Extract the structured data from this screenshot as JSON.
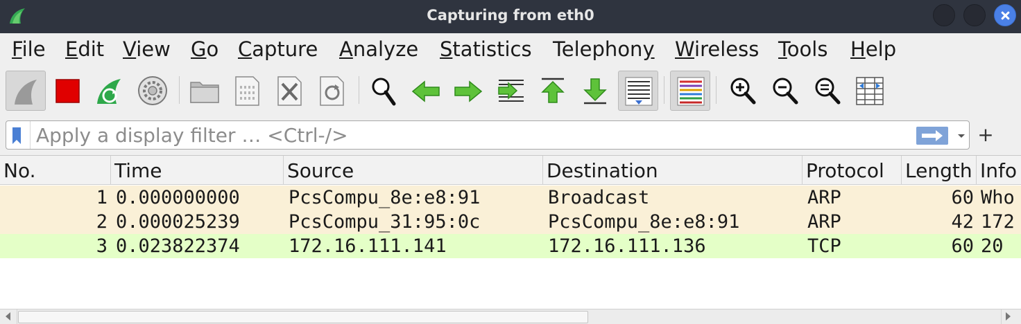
{
  "window": {
    "title": "Capturing from eth0",
    "buttons": [
      "minimize",
      "maximize",
      "close"
    ]
  },
  "menu": [
    {
      "label": "File",
      "mnemonic": "F",
      "rest": "ile"
    },
    {
      "label": "Edit",
      "mnemonic": "E",
      "rest": "dit"
    },
    {
      "label": "View",
      "mnemonic": "V",
      "rest": "iew"
    },
    {
      "label": "Go",
      "mnemonic": "G",
      "rest": "o"
    },
    {
      "label": "Capture",
      "mnemonic": "C",
      "rest": "apture"
    },
    {
      "label": "Analyze",
      "mnemonic": "A",
      "rest": "nalyze"
    },
    {
      "label": "Statistics",
      "mnemonic": "S",
      "rest": "tatistics"
    },
    {
      "label": "Telephony",
      "mnemonic": "y",
      "rest_before": "Telephon"
    },
    {
      "label": "Wireless",
      "mnemonic": "W",
      "rest": "ireless"
    },
    {
      "label": "Tools",
      "mnemonic": "T",
      "rest": "ools"
    },
    {
      "label": "Help",
      "mnemonic": "H",
      "rest": "elp"
    }
  ],
  "toolbar": {
    "icons": [
      "start-capture-icon",
      "stop-capture-icon",
      "restart-capture-icon",
      "capture-options-icon",
      "open-file-icon",
      "save-file-icon",
      "close-file-icon",
      "reload-file-icon",
      "find-packet-icon",
      "go-back-icon",
      "go-forward-icon",
      "go-to-packet-icon",
      "go-first-packet-icon",
      "go-last-packet-icon",
      "autoscroll-icon",
      "colorize-icon",
      "zoom-in-icon",
      "zoom-out-icon",
      "normal-size-icon",
      "resize-columns-icon"
    ]
  },
  "filter": {
    "placeholder": "Apply a display filter … <Ctrl-/>",
    "value": "",
    "add_label": "+"
  },
  "packets": {
    "columns": [
      "No.",
      "Time",
      "Source",
      "Destination",
      "Protocol",
      "Length",
      "Info"
    ],
    "rows": [
      {
        "no": "1",
        "time": "0.000000000",
        "source": "PcsCompu_8e:e8:91",
        "destination": "Broadcast",
        "protocol": "ARP",
        "length": "60",
        "info": "Who",
        "color": "#faf0d7"
      },
      {
        "no": "2",
        "time": "0.000025239",
        "source": "PcsCompu_31:95:0c",
        "destination": "PcsCompu_8e:e8:91",
        "protocol": "ARP",
        "length": "42",
        "info": "172",
        "color": "#faf0d7"
      },
      {
        "no": "3",
        "time": "0.023822374",
        "source": "172.16.111.141",
        "destination": "172.16.111.136",
        "protocol": "TCP",
        "length": "60",
        "info": "20",
        "color": "#e4ffc7"
      }
    ]
  },
  "colors": {
    "titlebar": "#2f343f",
    "close_button": "#4a80e6",
    "arp_row": "#faf0d7",
    "tcp_row": "#e4ffc7"
  }
}
